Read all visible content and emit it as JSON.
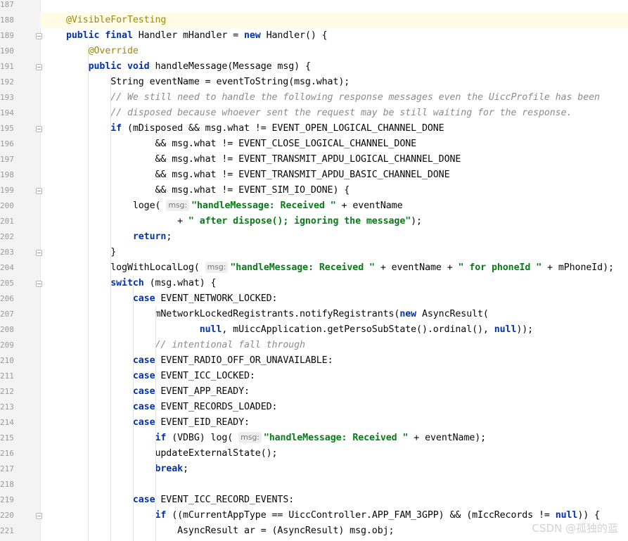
{
  "watermark": "CSDN @孤独的蓝",
  "lines": [
    {
      "n": "187",
      "html": ""
    },
    {
      "n": "188",
      "html": "<span class=\"ann\">@VisibleForTesting</span>",
      "current": true
    },
    {
      "n": "189",
      "html": "<span class=\"kw\">public final</span> Handler mHandler = <span class=\"kw\">new</span> Handler() {"
    },
    {
      "n": "190",
      "html": "    <span class=\"ann\">@Override</span>"
    },
    {
      "n": "191",
      "html": "    <span class=\"kw\">public void</span> handleMessage(Message msg) {"
    },
    {
      "n": "192",
      "html": "        String eventName = eventToString(msg.what);"
    },
    {
      "n": "193",
      "html": "        <span class=\"cm\">// We still need to handle the following response messages even the UiccProfile has been</span>"
    },
    {
      "n": "194",
      "html": "        <span class=\"cm\">// disposed because whoever sent the request may be still waiting for the response.</span>"
    },
    {
      "n": "195",
      "html": "        <span class=\"kw\">if</span> (mDisposed &amp;&amp; msg.what != EVENT_OPEN_LOGICAL_CHANNEL_DONE"
    },
    {
      "n": "196",
      "html": "                &amp;&amp; msg.what != EVENT_CLOSE_LOGICAL_CHANNEL_DONE"
    },
    {
      "n": "197",
      "html": "                &amp;&amp; msg.what != EVENT_TRANSMIT_APDU_LOGICAL_CHANNEL_DONE"
    },
    {
      "n": "198",
      "html": "                &amp;&amp; msg.what != EVENT_TRANSMIT_APDU_BASIC_CHANNEL_DONE"
    },
    {
      "n": "199",
      "html": "                &amp;&amp; msg.what != EVENT_SIM_IO_DONE) {"
    },
    {
      "n": "200",
      "html": "            loge( <span class=\"hint\">msg:</span><span class=\"str\">\"handleMessage: Received \"</span> + eventName"
    },
    {
      "n": "201",
      "html": "                    + <span class=\"str\">\" after dispose(); ignoring the message\"</span>);"
    },
    {
      "n": "202",
      "html": "            <span class=\"kw\">return</span>;"
    },
    {
      "n": "203",
      "html": "        }"
    },
    {
      "n": "204",
      "html": "        logWithLocalLog( <span class=\"hint\">msg:</span><span class=\"str\">\"handleMessage: Received \"</span> + eventName + <span class=\"str\">\" for phoneId \"</span> + mPhoneId);"
    },
    {
      "n": "205",
      "html": "        <span class=\"kw\">switch</span> (msg.what) {"
    },
    {
      "n": "206",
      "html": "            <span class=\"kw\">case</span> EVENT_NETWORK_LOCKED:"
    },
    {
      "n": "207",
      "html": "                mNetworkLockedRegistrants.notifyRegistrants(<span class=\"kw\">new</span> AsyncResult("
    },
    {
      "n": "208",
      "html": "                        <span class=\"kw\">null</span>, mUiccApplication.getPersoSubState().ordinal(), <span class=\"kw\">null</span>));"
    },
    {
      "n": "209",
      "html": "                <span class=\"cm\">// intentional fall through</span>"
    },
    {
      "n": "210",
      "html": "            <span class=\"kw\">case</span> EVENT_RADIO_OFF_OR_UNAVAILABLE:"
    },
    {
      "n": "211",
      "html": "            <span class=\"kw\">case</span> EVENT_ICC_LOCKED:"
    },
    {
      "n": "212",
      "html": "            <span class=\"kw\">case</span> EVENT_APP_READY:"
    },
    {
      "n": "213",
      "html": "            <span class=\"kw\">case</span> EVENT_RECORDS_LOADED:"
    },
    {
      "n": "214",
      "html": "            <span class=\"kw\">case</span> EVENT_EID_READY:"
    },
    {
      "n": "215",
      "html": "                <span class=\"kw\">if</span> (VDBG) log( <span class=\"hint\">msg:</span><span class=\"str\">\"handleMessage: Received \"</span> + eventName);"
    },
    {
      "n": "216",
      "html": "                updateExternalState();"
    },
    {
      "n": "217",
      "html": "                <span class=\"kw\">break</span>;"
    },
    {
      "n": "218",
      "html": ""
    },
    {
      "n": "219",
      "html": "            <span class=\"kw\">case</span> EVENT_ICC_RECORD_EVENTS:"
    },
    {
      "n": "220",
      "html": "                <span class=\"kw\">if</span> ((mCurrentAppType == UiccController.APP_FAM_3GPP) &amp;&amp; (mIccRecords != <span class=\"kw\">null</span>)) {"
    },
    {
      "n": "221",
      "html": "                    AsyncResult ar = (AsyncResult) msg.obj;"
    }
  ]
}
